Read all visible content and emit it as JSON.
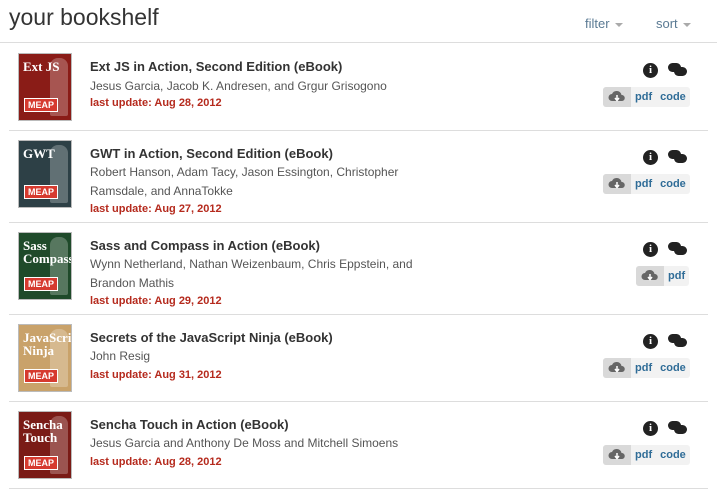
{
  "header": {
    "title": "your bookshelf",
    "filter_label": "filter",
    "sort_label": "sort"
  },
  "books": [
    {
      "title": "Ext JS in Action, Second Edition (eBook)",
      "authors": "Jesus Garcia, Jacob K. Andresen, and Grgur Grisogono",
      "update": "last update: Aug 28, 2012",
      "cover_text": "Ext JS",
      "cover_color": "#8a1c17",
      "downloads": [
        "pdf",
        "code"
      ]
    },
    {
      "title": "GWT in Action, Second Edition (eBook)",
      "authors": "Robert Hanson, Adam Tacy, Jason Essington, Christopher Ramsdale, and AnnaTokke",
      "update": "last update: Aug 27, 2012",
      "cover_text": "GWT",
      "cover_color": "#2d4046",
      "downloads": [
        "pdf",
        "code"
      ]
    },
    {
      "title": "Sass and Compass in Action (eBook)",
      "authors": "Wynn Netherland, Nathan Weizenbaum, Chris Eppstein, and Brandon Mathis",
      "update": "last update: Aug 29, 2012",
      "cover_text": "Sass Compass",
      "cover_color": "#1f4a2a",
      "downloads": [
        "pdf"
      ]
    },
    {
      "title": "Secrets of the JavaScript Ninja (eBook)",
      "authors": "John Resig",
      "update": "last update: Aug 31, 2012",
      "cover_text": "JavaScript Ninja",
      "cover_color": "#c9a26a",
      "downloads": [
        "pdf",
        "code"
      ]
    },
    {
      "title": "Sencha Touch in Action (eBook)",
      "authors": "Jesus Garcia and Anthony De Moss and Mitchell Simoens",
      "update": "last update: Aug 28, 2012",
      "cover_text": "Sencha Touch",
      "cover_color": "#7a1b16",
      "downloads": [
        "pdf",
        "code"
      ]
    }
  ],
  "cover_badge": "MEAP",
  "icons": {
    "info": "info-icon",
    "comments": "comments-icon",
    "download": "cloud-download-icon"
  },
  "colors": {
    "update_red": "#b52a1d",
    "link_blue": "#2f6c97"
  }
}
